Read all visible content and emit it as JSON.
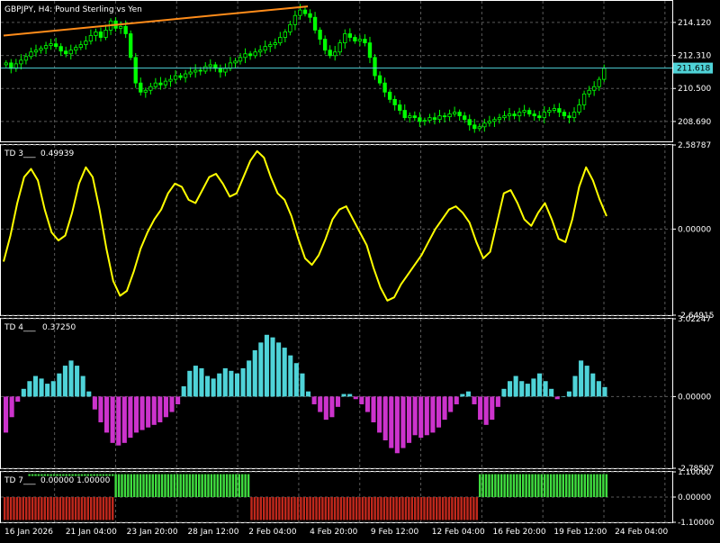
{
  "window": {
    "symbol_label": "GBPJPY, H4:  Pound Sterling vs Yen"
  },
  "colors": {
    "background": "#000000",
    "candle": "#00ff00",
    "bid_line": "#4fd3d8",
    "trendline": "#ff8c1a",
    "td3_line": "#ffff00",
    "td4_positive": "#4fd3d8",
    "td4_negative": "#cc33cc",
    "td7_positive": "#3fdc3f",
    "td7_negative": "#c0281c",
    "grid": "#5a5a5a"
  },
  "x_axis_labels": [
    "16 Jan 2026",
    "21 Jan 04:00",
    "23 Jan 20:00",
    "28 Jan 12:00",
    "2 Feb 04:00",
    "4 Feb 20:00",
    "9 Feb 12:00",
    "12 Feb 04:00",
    "16 Feb 20:00",
    "19 Feb 12:00",
    "24 Feb 04:00"
  ],
  "chart_data": [
    {
      "type": "candlestick",
      "title": "GBPJPY, H4:  Pound Sterling vs Yen",
      "ylim": [
        207.6,
        215.3
      ],
      "y_ticks": [
        "214.120",
        "212.310",
        "210.500",
        "208.690"
      ],
      "current_price_label": "211.618",
      "current_price": 211.618,
      "trendline": {
        "from": {
          "bar": 0,
          "price": 213.4
        },
        "to": {
          "bar": 111,
          "price": 215.0
        }
      },
      "close_series": [
        211.9,
        211.6,
        211.85,
        212.05,
        212.25,
        212.5,
        212.6,
        212.7,
        212.85,
        212.95,
        212.8,
        212.55,
        212.4,
        212.6,
        212.75,
        212.9,
        213.1,
        213.4,
        213.6,
        213.3,
        213.7,
        214.2,
        213.8,
        213.9,
        213.5,
        212.2,
        210.8,
        210.3,
        210.4,
        210.6,
        210.8,
        210.7,
        210.9,
        211.0,
        211.2,
        211.1,
        211.3,
        211.4,
        211.5,
        211.45,
        211.7,
        211.8,
        211.6,
        211.4,
        211.6,
        211.9,
        212.0,
        212.2,
        212.4,
        212.3,
        212.5,
        212.6,
        212.8,
        212.9,
        213.0,
        213.3,
        213.6,
        214.0,
        214.5,
        214.8,
        214.6,
        214.4,
        213.7,
        213.2,
        212.6,
        212.3,
        212.5,
        213.0,
        213.5,
        213.3,
        213.1,
        213.2,
        213.0,
        212.2,
        211.2,
        210.8,
        210.3,
        209.9,
        209.6,
        209.3,
        208.9,
        209.0,
        208.9,
        208.7,
        208.75,
        208.9,
        208.8,
        209.0,
        208.95,
        209.1,
        209.2,
        209.0,
        208.8,
        208.5,
        208.3,
        208.4,
        208.6,
        208.7,
        208.8,
        208.9,
        209.0,
        209.1,
        209.0,
        209.2,
        209.3,
        209.1,
        209.0,
        208.9,
        209.2,
        209.3,
        209.4,
        209.2,
        209.0,
        208.9,
        209.2,
        209.6,
        210.2,
        210.4,
        210.6,
        211.0,
        211.6
      ]
    },
    {
      "type": "line",
      "name": "TD 3",
      "header": "TD 3___",
      "value_label": "0.49939",
      "ylim": [
        -2.64915,
        2.58787
      ],
      "y_ticks": [
        "2.58787",
        "0.00000",
        "-2.64915"
      ],
      "values": [
        -1.0,
        -0.2,
        0.8,
        1.6,
        1.85,
        1.5,
        0.6,
        -0.1,
        -0.35,
        -0.2,
        0.5,
        1.4,
        1.9,
        1.6,
        0.6,
        -0.6,
        -1.6,
        -2.05,
        -1.9,
        -1.3,
        -0.6,
        -0.1,
        0.3,
        0.6,
        1.1,
        1.4,
        1.3,
        0.9,
        0.8,
        1.2,
        1.6,
        1.7,
        1.4,
        1.0,
        1.1,
        1.6,
        2.1,
        2.4,
        2.2,
        1.6,
        1.1,
        0.9,
        0.4,
        -0.3,
        -0.9,
        -1.1,
        -0.8,
        -0.3,
        0.3,
        0.6,
        0.7,
        0.3,
        -0.1,
        -0.5,
        -1.2,
        -1.8,
        -2.2,
        -2.1,
        -1.7,
        -1.4,
        -1.1,
        -0.8,
        -0.4,
        0.0,
        0.3,
        0.6,
        0.7,
        0.5,
        0.2,
        -0.4,
        -0.9,
        -0.7,
        0.2,
        1.1,
        1.2,
        0.8,
        0.3,
        0.1,
        0.5,
        0.8,
        0.3,
        -0.3,
        -0.4,
        0.3,
        1.3,
        1.9,
        1.5,
        0.9,
        0.4
      ]
    },
    {
      "type": "bar",
      "name": "TD 4",
      "header": "TD 4___",
      "value_label": "0.37250",
      "ylim": [
        -2.78507,
        3.02247
      ],
      "y_ticks": [
        "3.02247",
        "0.00000",
        "-2.78507"
      ],
      "values": [
        -1.4,
        -0.8,
        -0.2,
        0.3,
        0.6,
        0.8,
        0.7,
        0.5,
        0.6,
        0.9,
        1.2,
        1.4,
        1.2,
        0.8,
        0.2,
        -0.5,
        -1.0,
        -1.4,
        -1.8,
        -1.9,
        -1.8,
        -1.6,
        -1.4,
        -1.3,
        -1.2,
        -1.1,
        -1.0,
        -0.8,
        -0.6,
        -0.3,
        0.4,
        1.0,
        1.2,
        1.1,
        0.8,
        0.7,
        0.9,
        1.1,
        1.0,
        0.9,
        1.1,
        1.4,
        1.8,
        2.1,
        2.4,
        2.3,
        2.1,
        1.9,
        1.6,
        1.3,
        0.9,
        0.2,
        -0.3,
        -0.6,
        -0.9,
        -0.8,
        -0.4,
        0.1,
        0.1,
        -0.1,
        -0.3,
        -0.6,
        -1.0,
        -1.4,
        -1.7,
        -2.0,
        -2.2,
        -2.0,
        -1.8,
        -1.5,
        -1.6,
        -1.5,
        -1.4,
        -1.2,
        -0.9,
        -0.6,
        -0.3,
        0.1,
        0.2,
        -0.3,
        -0.9,
        -1.1,
        -0.9,
        -0.4,
        0.3,
        0.6,
        0.8,
        0.6,
        0.5,
        0.7,
        0.9,
        0.6,
        0.3,
        -0.1,
        0.0,
        0.2,
        0.8,
        1.4,
        1.2,
        0.9,
        0.6,
        0.37
      ]
    },
    {
      "type": "bar",
      "name": "TD 7",
      "header": "TD 7___",
      "value_label": "0.00000 1.00000",
      "ylim": [
        -1.1,
        1.1
      ],
      "y_ticks": [
        "1.10000",
        "0.00000",
        "-1.10000"
      ],
      "segments": [
        {
          "bars": 8,
          "value": -1
        },
        {
          "bars": 28,
          "value": -1
        },
        {
          "bars": 44,
          "value": 1
        },
        {
          "bars": 74,
          "value": -1
        },
        {
          "bars": 42,
          "value": 1
        }
      ],
      "top_bar_series": {
        "from_bar": 8,
        "to_bar": 36,
        "value": 1
      }
    }
  ]
}
